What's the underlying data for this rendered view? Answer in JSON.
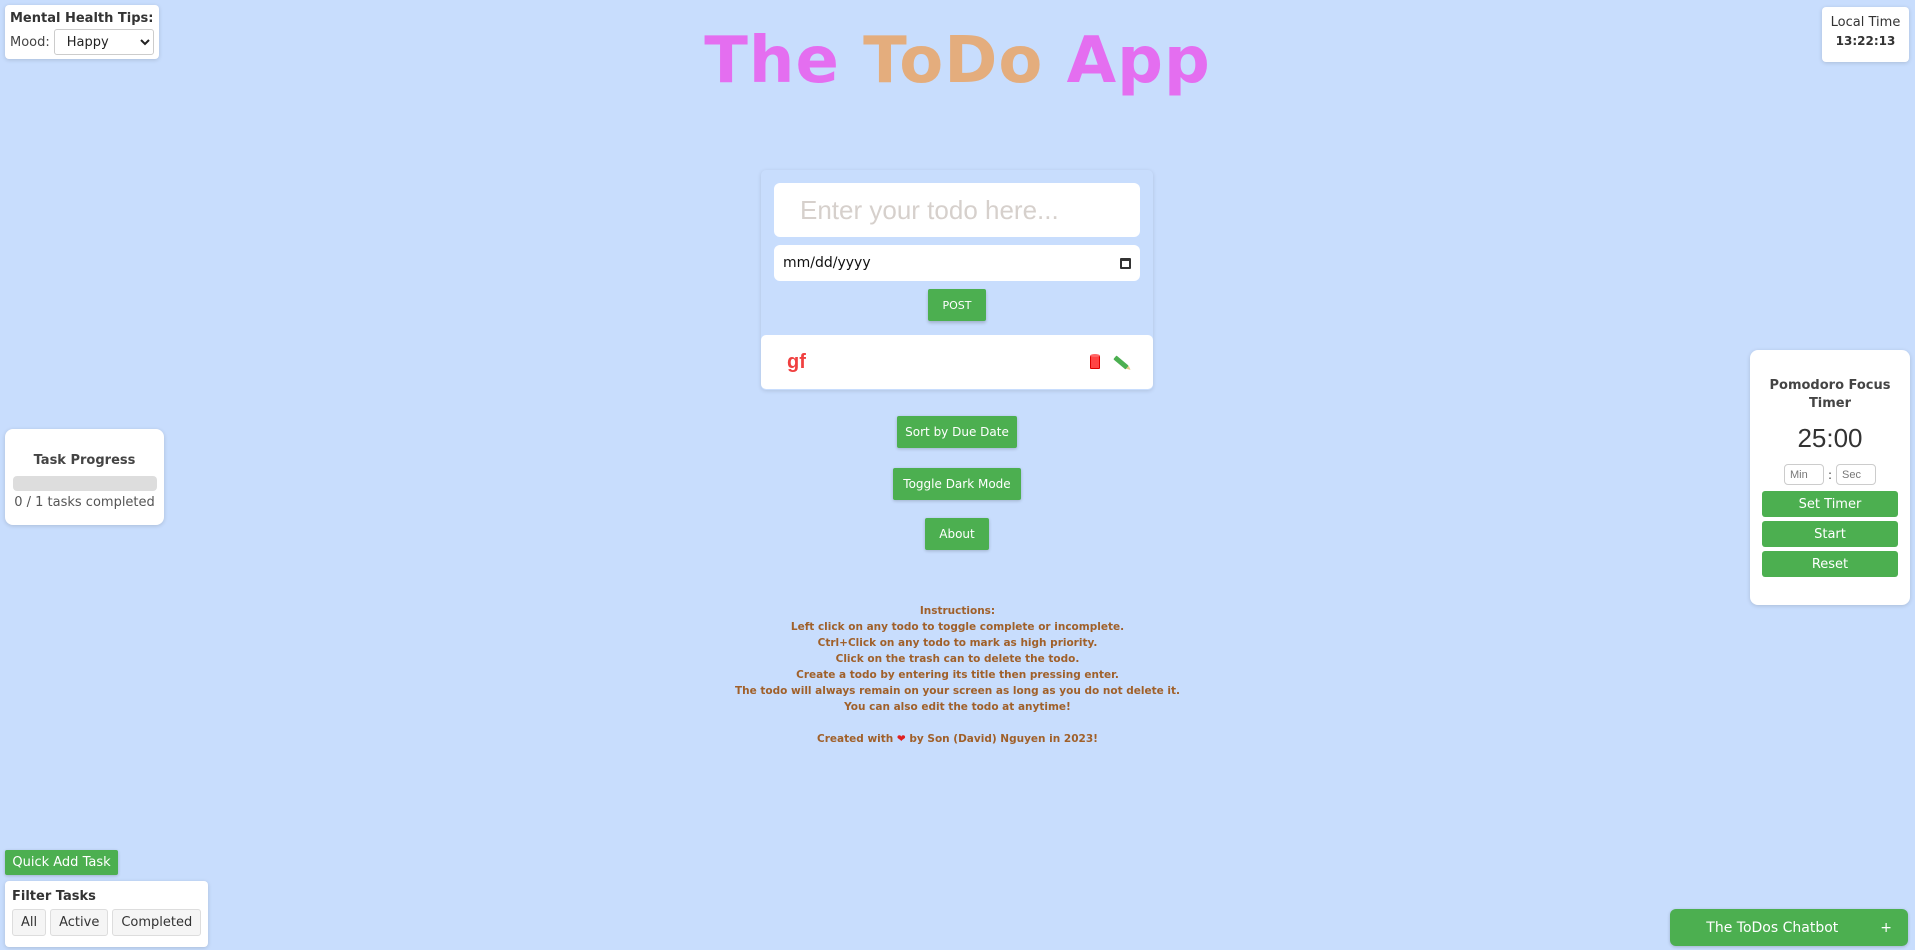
{
  "mood_widget": {
    "title": "Mental Health Tips:",
    "mood_label": "Mood:",
    "mood_selected": "Happy"
  },
  "header": {
    "title_part1": "The",
    "title_part2": "ToDo",
    "title_part3": "App",
    "colors": {
      "pink": "#e46ef0",
      "orange": "#e4ad7d"
    }
  },
  "clock": {
    "label": "Local Time",
    "time": "13:22:13"
  },
  "form": {
    "todo_placeholder": "Enter your todo here...",
    "date_placeholder": "mm/dd/yyyy",
    "post_label": "POST"
  },
  "todos": [
    {
      "title": "gf",
      "completed": false,
      "color": "#f04040"
    }
  ],
  "actions": {
    "sort_label": "Sort by Due Date",
    "dark_mode_label": "Toggle Dark Mode",
    "about_label": "About"
  },
  "instructions": {
    "heading": "Instructions:",
    "lines": [
      "Left click on any todo to toggle complete or incomplete.",
      "Ctrl+Click on any todo to mark as high priority.",
      "Click on the trash can to delete the todo.",
      "Create a todo by entering its title then pressing enter.",
      "The todo will always remain on your screen as long as you do not delete it.",
      "You can also edit the todo at anytime!"
    ],
    "credit_before": "Created with",
    "credit_heart": "❤",
    "credit_after": "by Son (David) Nguyen in 2023!"
  },
  "progress": {
    "title": "Task Progress",
    "completed": 0,
    "total": 1,
    "fraction": 0,
    "summary": "0 / 1 tasks completed"
  },
  "pomodoro": {
    "title": "Pomodoro Focus Timer",
    "time": "25:00",
    "min_placeholder": "Min",
    "sec_placeholder": "Sec",
    "separator": ":",
    "set_label": "Set Timer",
    "start_label": "Start",
    "reset_label": "Reset"
  },
  "quick_add": {
    "label": "Quick Add Task"
  },
  "filter": {
    "title": "Filter Tasks",
    "options": [
      "All",
      "Active",
      "Completed"
    ]
  },
  "chatbot": {
    "label": "The ToDos Chatbot",
    "toggle": "+"
  },
  "theme": {
    "background": "#c8ddfd",
    "accent": "#4caf50"
  }
}
